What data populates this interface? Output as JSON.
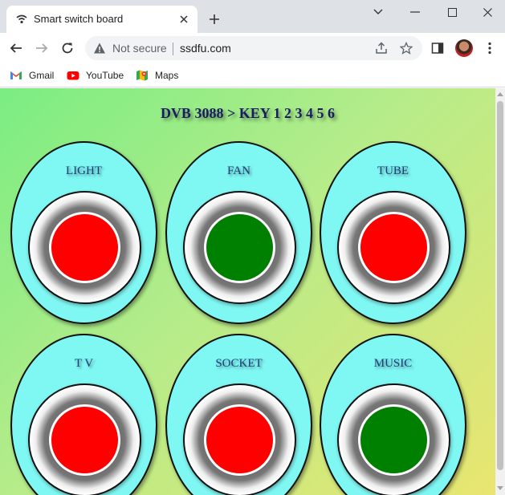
{
  "browser": {
    "tab_title": "Smart switch board",
    "security_label": "Not secure",
    "url": "ssdfu.com",
    "bookmarks": [
      {
        "label": "Gmail",
        "icon": "gmail-icon"
      },
      {
        "label": "YouTube",
        "icon": "youtube-icon"
      },
      {
        "label": "Maps",
        "icon": "maps-icon"
      }
    ]
  },
  "page": {
    "heading": "DVB 3088 > KEY 1 2 3 4 5 6",
    "switches": [
      {
        "label": "LIGHT",
        "state": "off",
        "color": "#ff0000"
      },
      {
        "label": "FAN",
        "state": "on",
        "color": "#008000"
      },
      {
        "label": "TUBE",
        "state": "off",
        "color": "#ff0000"
      },
      {
        "label": "T V",
        "state": "off",
        "color": "#ff0000"
      },
      {
        "label": "SOCKET",
        "state": "off",
        "color": "#ff0000"
      },
      {
        "label": "MUSIC",
        "state": "on",
        "color": "#008000"
      }
    ]
  }
}
